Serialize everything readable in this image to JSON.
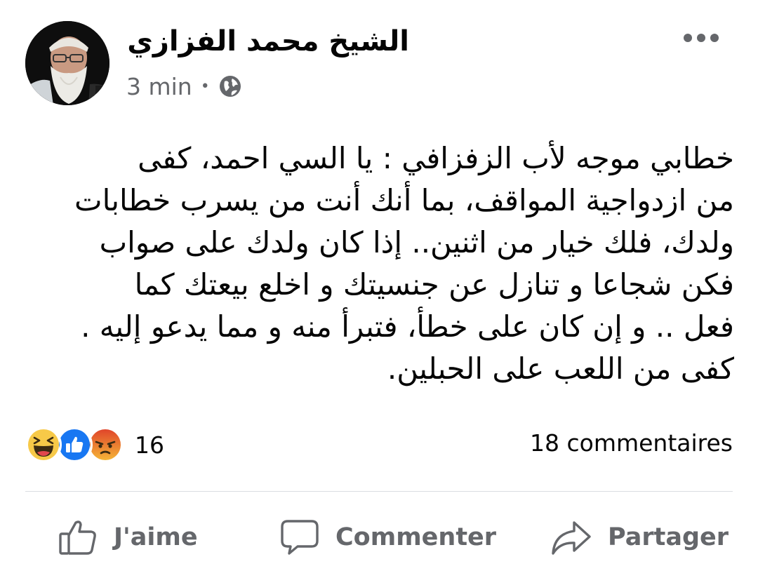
{
  "post": {
    "author": "الشيخ محمد الفزازي",
    "time": "3 min",
    "separator": "•",
    "privacy_icon": "globe-icon",
    "more_icon": "more-options-icon",
    "text_lines": [
      "خطابي موجه لأب الزفزافي : يا السي احمد، كفى",
      "من ازدواجية المواقف، بما أنك أنت من يسرب خطابات",
      "ولدك، فلك خيار من اثنين.. إذا كان ولدك على صواب",
      "فكن شجاعا و تنازل عن جنسيتك و اخلع بيعتك كما",
      "فعل .. و إن كان على خطأ، فتبرأ منه و مما يدعو إليه .",
      "كفى من اللعب على الحبلين."
    ]
  },
  "stats": {
    "reaction_icons": [
      "haha-icon",
      "like-icon",
      "angry-icon"
    ],
    "reaction_count": "16",
    "comments": "18 commentaires"
  },
  "actions": {
    "like": "J'aime",
    "comment": "Commenter",
    "share": "Partager"
  },
  "colors": {
    "text": "#050505",
    "secondary": "#65676b",
    "like_blue": "#1877f2",
    "haha_yellow": "#f7c948",
    "angry_orange": "#e9710f",
    "divider": "#dadde1"
  }
}
